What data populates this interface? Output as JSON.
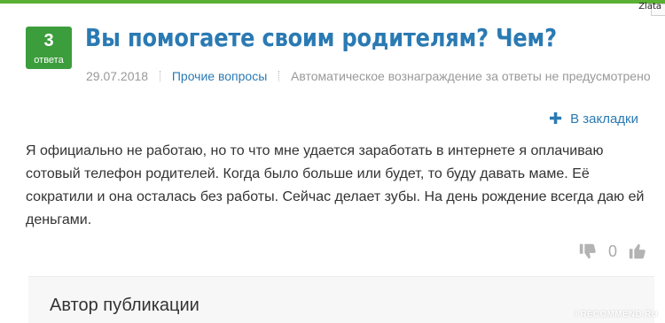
{
  "corner_tag": "Zlata",
  "question": {
    "answers_count": "3",
    "answers_label": "ответа",
    "title": "Вы помогаете своим родителям? Чем?",
    "date": "29.07.2018",
    "category": "Прочие вопросы",
    "reward_note": "Автоматическое вознаграждение за ответы не предусмотрено"
  },
  "bookmark": {
    "icon": "plus-icon",
    "label": "В закладки"
  },
  "answer": {
    "text": "Я официально не работаю, но то что мне удается заработать в интернете я оплачиваю сотовый телефон родителей. Когда было больше или будет, то буду давать маме. Её сократили и она осталась без работы. Сейчас делает зубы. На день рождение всегда даю ей деньгами."
  },
  "votes": {
    "down_icon": "thumbs-down-icon",
    "count": "0",
    "up_icon": "thumbs-up-icon"
  },
  "author_section": {
    "title": "Автор публикации"
  },
  "watermark": "I RECOMMEND.RU",
  "colors": {
    "accent_green": "#3c9d3c",
    "link_blue": "#2a7ab3",
    "muted": "#999999"
  }
}
